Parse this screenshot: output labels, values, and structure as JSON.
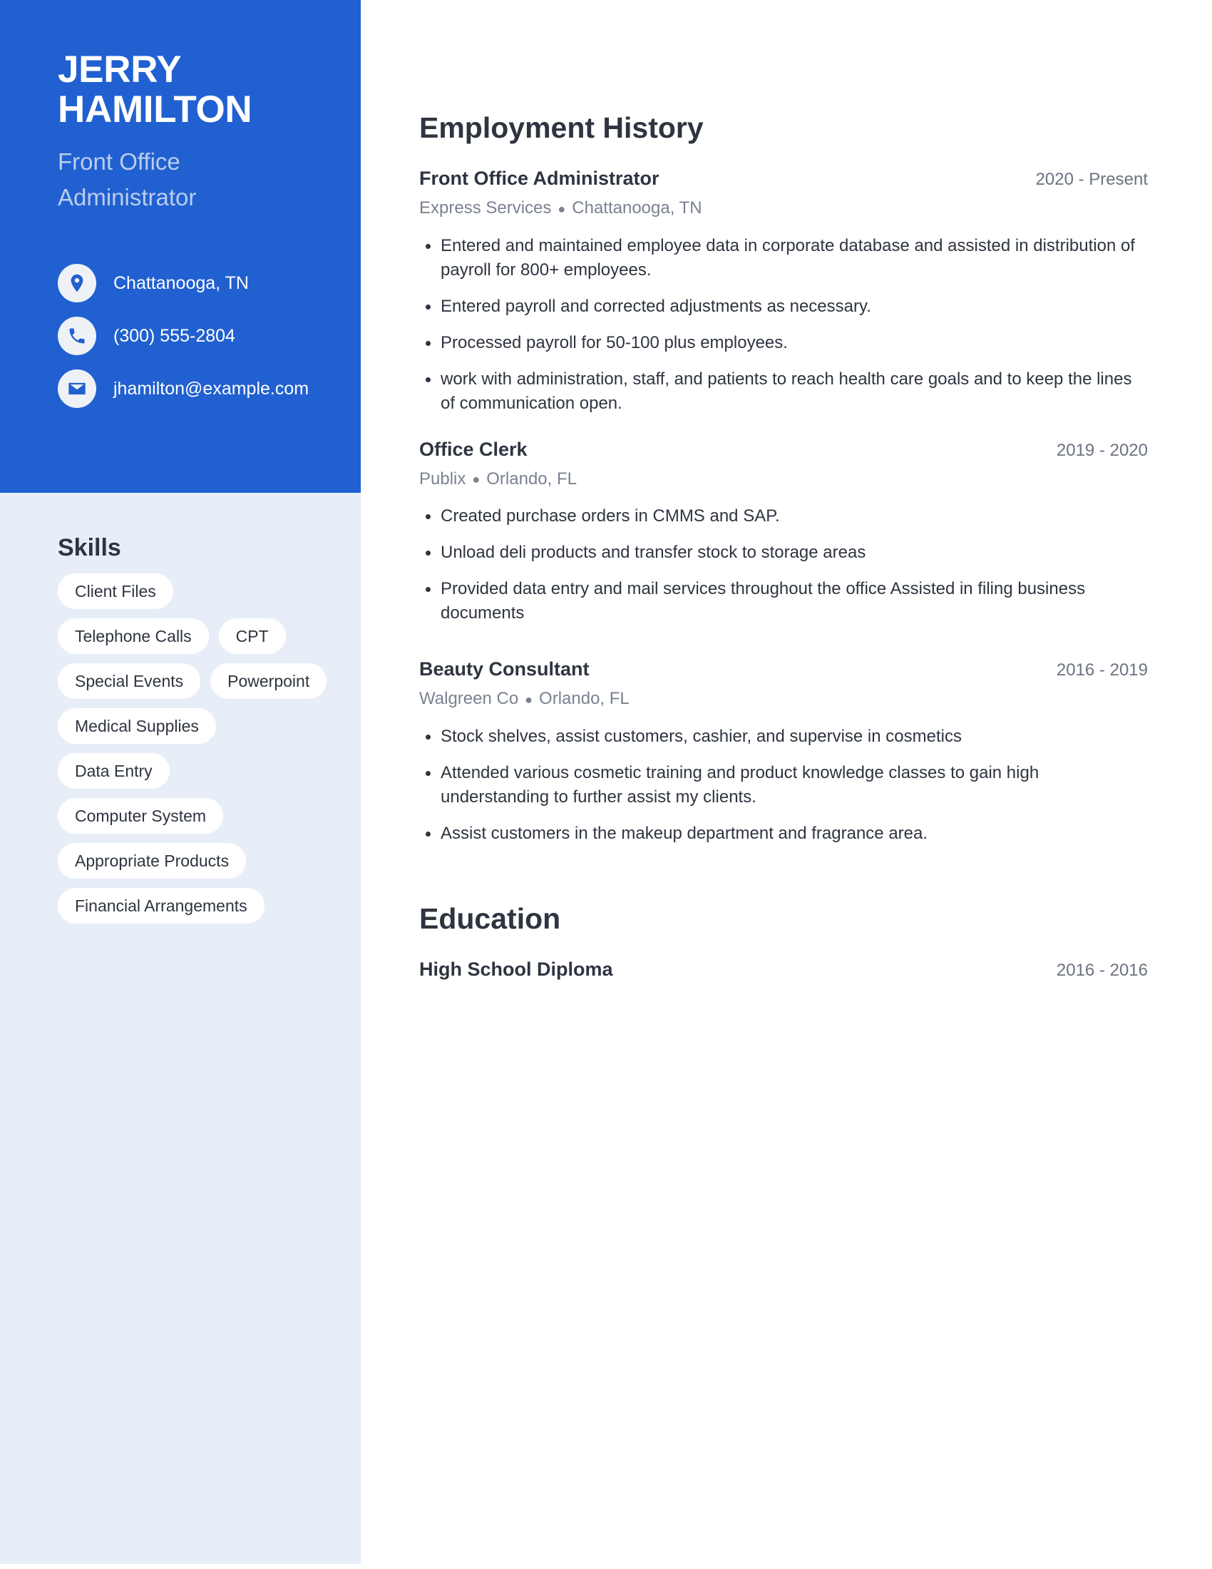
{
  "theme": {
    "accent": "#2160d0",
    "sidebar_bg": "#e8eef8",
    "pill_bg": "#ffffff",
    "text_dark": "#2e3440",
    "text_muted": "#7a8290",
    "subtitle_light": "#b9cdee"
  },
  "header": {
    "first_name": "JERRY",
    "last_name": "HAMILTON",
    "job_title_line1": "Front Office",
    "job_title_line2": "Administrator"
  },
  "contact": {
    "items": [
      {
        "icon": "location-pin-icon",
        "value": "Chattanooga, TN"
      },
      {
        "icon": "phone-icon",
        "value": "(300) 555-2804"
      },
      {
        "icon": "email-icon",
        "value": "jhamilton@example.com"
      }
    ]
  },
  "skills": {
    "heading": "Skills",
    "items": [
      "Client Files",
      "Telephone Calls",
      "CPT",
      "Special Events",
      "Powerpoint",
      "Medical Supplies",
      "Data Entry",
      "Computer System",
      "Appropriate Products",
      "Financial Arrangements"
    ]
  },
  "employment": {
    "heading": "Employment History",
    "entries": [
      {
        "role": "Front Office Administrator",
        "dates": "2020 - Present",
        "company": "Express Services",
        "location": "Chattanooga, TN",
        "bullets": [
          "Entered and maintained employee data in corporate database and assisted in distribution of payroll for 800+ employees.",
          "Entered payroll and corrected adjustments as necessary.",
          "Processed payroll for 50-100 plus employees.",
          "work with administration, staff, and patients to reach health care goals and to keep the lines of communication open."
        ]
      },
      {
        "role": "Office Clerk",
        "dates": "2019 - 2020",
        "company": "Publix",
        "location": "Orlando, FL",
        "bullets": [
          "Created purchase orders in CMMS and SAP.",
          "Unload deli products and transfer stock to storage areas",
          "Provided data entry and mail services throughout the office Assisted in filing business documents"
        ]
      },
      {
        "role": "Beauty Consultant",
        "dates": "2016 - 2019",
        "company": "Walgreen Co",
        "location": "Orlando, FL",
        "bullets": [
          "Stock shelves, assist customers, cashier, and supervise in cosmetics",
          "Attended various cosmetic training and product knowledge classes to gain high understanding to further assist my clients.",
          "Assist customers in the makeup department and fragrance area."
        ]
      }
    ]
  },
  "education": {
    "heading": "Education",
    "entries": [
      {
        "degree": "High School Diploma",
        "dates": "2016 - 2016"
      }
    ]
  }
}
